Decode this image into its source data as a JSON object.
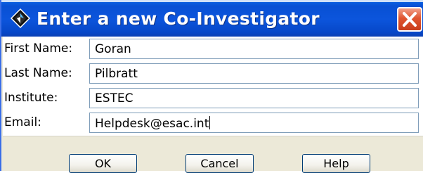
{
  "window": {
    "title": "Enter a new Co-Investigator",
    "app_icon": "diamond-app-icon",
    "close_icon": "close-x-icon"
  },
  "form": {
    "fields": [
      {
        "label": "First Name:",
        "value": "Goran"
      },
      {
        "label": "Last Name:",
        "value": "Pilbratt"
      },
      {
        "label": "Institute:",
        "value": "ESTEC"
      },
      {
        "label": "Email:",
        "value": "Helpdesk@esac.int"
      }
    ]
  },
  "buttons": {
    "ok": "OK",
    "cancel": "Cancel",
    "help": "Help"
  },
  "colors": {
    "titlebar": "#0a52d8",
    "close": "#e0552f",
    "dialog_bg": "#ece9d8"
  }
}
